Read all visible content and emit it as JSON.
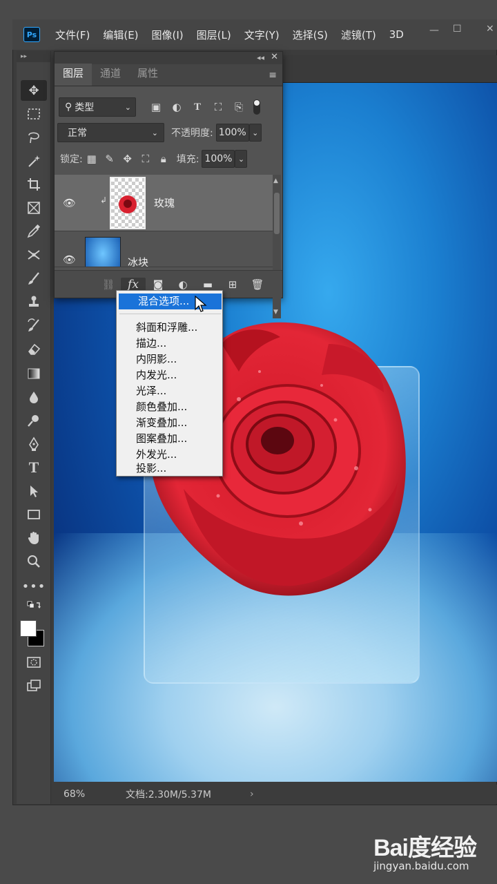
{
  "menubar": {
    "app_icon": "Ps",
    "items": [
      "文件(F)",
      "编辑(E)",
      "图像(I)",
      "图层(L)",
      "文字(Y)",
      "选择(S)",
      "滤镜(T)",
      "3D"
    ]
  },
  "layers_panel": {
    "tabs": [
      "图层",
      "通道",
      "属性"
    ],
    "filter_kind": "类型",
    "blend_mode": "正常",
    "opacity_label": "不透明度:",
    "opacity_value": "100%",
    "lock_label": "锁定:",
    "fill_label": "填充:",
    "fill_value": "100%",
    "layers": [
      {
        "name": "玫瑰",
        "selected": true
      },
      {
        "name": "冰块",
        "selected": false
      }
    ]
  },
  "fx_menu": {
    "items": [
      "混合选项...",
      "斜面和浮雕...",
      "描边...",
      "内阴影...",
      "内发光...",
      "光泽...",
      "颜色叠加...",
      "渐变叠加...",
      "图案叠加...",
      "外发光...",
      "投影..."
    ]
  },
  "statusbar": {
    "zoom": "68%",
    "doc_info": "文档:2.30M/5.37M"
  },
  "watermark": {
    "logo": "Bai度经验",
    "url": "jingyan.baidu.com"
  },
  "colors": {
    "accent": "#1a73d9",
    "ps_blue": "#31a8ff"
  }
}
